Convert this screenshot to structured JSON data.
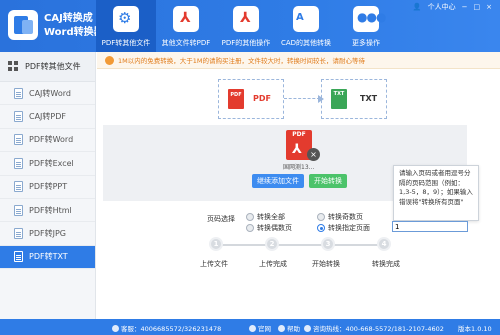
{
  "app": {
    "title_line1": "CAJ转换成",
    "title_line2": "Word转换器",
    "user_label": "个人中心",
    "window_controls": [
      "−",
      "□",
      "×"
    ]
  },
  "topnav": [
    {
      "label": "PDF转其他文件",
      "icon": "gear-icon",
      "active": true
    },
    {
      "label": "其他文件转PDF",
      "icon": "pdf-icon",
      "active": false
    },
    {
      "label": "PDF的其他操作",
      "icon": "pdf-icon",
      "active": false
    },
    {
      "label": "CAD的其他转换",
      "icon": "cad-icon",
      "glyph": "A",
      "active": false
    },
    {
      "label": "更多操作",
      "icon": "more-icon",
      "active": false
    }
  ],
  "sidebar": {
    "header": "PDF转其他文件",
    "items": [
      {
        "label": "CAJ转Word",
        "active": false
      },
      {
        "label": "CAJ转PDF",
        "active": false
      },
      {
        "label": "PDF转Word",
        "active": false
      },
      {
        "label": "PDF转Excel",
        "active": false
      },
      {
        "label": "PDF转PPT",
        "active": false
      },
      {
        "label": "PDF转Html",
        "active": false
      },
      {
        "label": "PDF转JPG",
        "active": false
      },
      {
        "label": "PDF转TXT",
        "active": true
      }
    ]
  },
  "notice": "1M以内的免费转换，大于1M的请购买注册，文件较大时，转换时间较长，请耐心等待",
  "flow": {
    "from_label": "PDF",
    "to_label": "TXT",
    "from_icon_text": "PDF",
    "to_icon_text": "TXT"
  },
  "file": {
    "name": "国网测13...",
    "icon_text": "PDF",
    "remove_symbol": "×"
  },
  "buttons": {
    "add": "继续添加文件",
    "start": "开始转换"
  },
  "tooltip": "请输入页码或者用逗号分隔的页码范围（例如：1,3-5，8，9）；如果输入错误将\"转换所有页面\"",
  "page_select": {
    "label": "页码选择",
    "options": [
      {
        "label": "转换全部",
        "selected": false
      },
      {
        "label": "转换奇数页",
        "selected": false
      },
      {
        "label": "转换偶数页",
        "selected": false
      },
      {
        "label": "转换指定页面",
        "selected": true
      }
    ],
    "input_value": "1"
  },
  "steps": [
    {
      "num": "1",
      "label": "上传文件"
    },
    {
      "num": "2",
      "label": "上传完成"
    },
    {
      "num": "3",
      "label": "开始转换"
    },
    {
      "num": "4",
      "label": "转换完成"
    }
  ],
  "footer": {
    "qq": "客服：4006685572/326231478",
    "website": "官网",
    "help": "帮助",
    "phone": "咨询热线：400-668-5572/181-2107-4602",
    "version": "版本1.0.10"
  },
  "colors": {
    "primary": "#2f7ce6",
    "pdf_red": "#e33b2e",
    "txt_green": "#3aa657",
    "start_green": "#4cc36a",
    "notice_orange": "#e07b1a"
  }
}
